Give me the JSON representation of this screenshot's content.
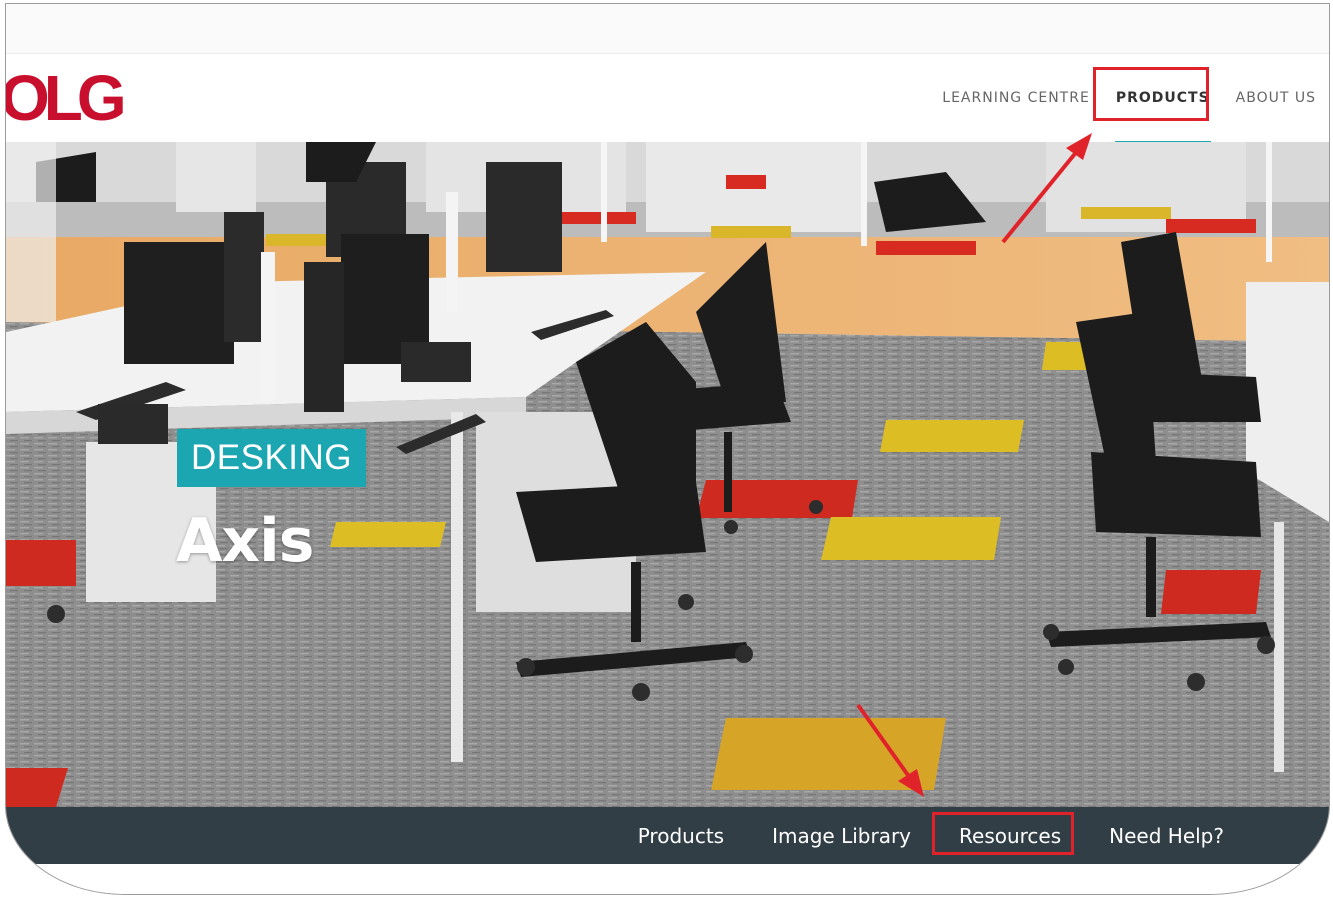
{
  "header": {
    "logo_text": "OLG",
    "nav": [
      {
        "label": "LEARNING CENTRE",
        "active": false
      },
      {
        "label": "PRODUCTS",
        "active": true
      },
      {
        "label": "ABOUT US",
        "active": false
      }
    ]
  },
  "hero": {
    "category": "DESKING",
    "title": "Axis"
  },
  "subnav": [
    {
      "label": "Products"
    },
    {
      "label": "Image Library"
    },
    {
      "label": "Resources"
    },
    {
      "label": "Need Help?"
    }
  ],
  "colors": {
    "brand_red": "#c8102e",
    "accent_teal": "#1ba6b1",
    "subnav_bg": "#323e46",
    "annotation_red": "#e0232a"
  },
  "icons": [
    "arrow-annotation-icon"
  ]
}
